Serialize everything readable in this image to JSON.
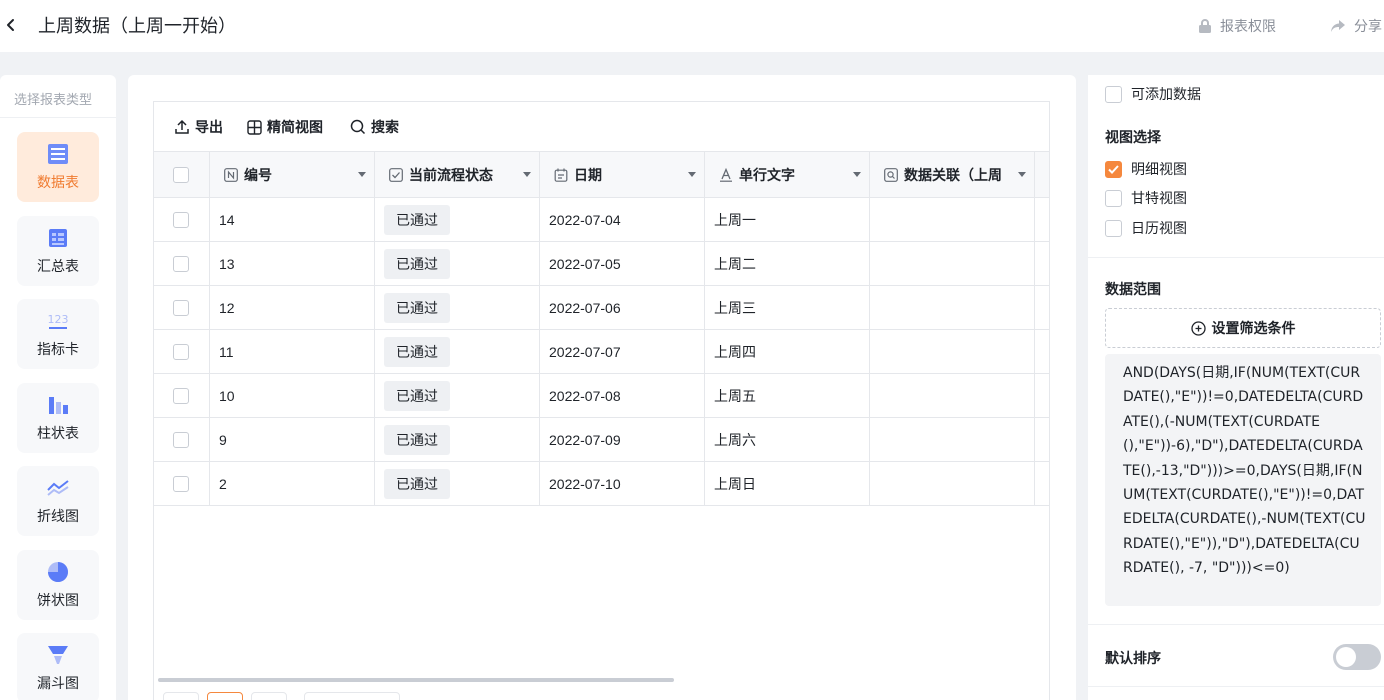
{
  "header": {
    "title": "上周数据（上周一开始）",
    "permissions_label": "报表权限",
    "share_label": "分享"
  },
  "left_panel": {
    "title": "选择报表类型",
    "types": [
      {
        "label": "数据表",
        "icon": "table-icon",
        "active": true
      },
      {
        "label": "汇总表",
        "icon": "pivot-table-icon",
        "active": false
      },
      {
        "label": "指标卡",
        "icon": "metric-card-icon",
        "active": false
      },
      {
        "label": "柱状表",
        "icon": "bar-chart-icon",
        "active": false
      },
      {
        "label": "折线图",
        "icon": "line-chart-icon",
        "active": false
      },
      {
        "label": "饼状图",
        "icon": "pie-chart-icon",
        "active": false
      },
      {
        "label": "漏斗图",
        "icon": "funnel-chart-icon",
        "active": false
      }
    ]
  },
  "toolbar": {
    "export_label": "导出",
    "compact_view_label": "精简视图",
    "search_label": "搜索"
  },
  "table": {
    "columns": [
      "编号",
      "当前流程状态",
      "日期",
      "单行文字",
      "数据关联（上周"
    ],
    "rows": [
      {
        "id": "14",
        "status": "已通过",
        "date": "2022-07-04",
        "text": "上周一",
        "relation": ""
      },
      {
        "id": "13",
        "status": "已通过",
        "date": "2022-07-05",
        "text": "上周二",
        "relation": ""
      },
      {
        "id": "12",
        "status": "已通过",
        "date": "2022-07-06",
        "text": "上周三",
        "relation": ""
      },
      {
        "id": "11",
        "status": "已通过",
        "date": "2022-07-07",
        "text": "上周四",
        "relation": ""
      },
      {
        "id": "10",
        "status": "已通过",
        "date": "2022-07-08",
        "text": "上周五",
        "relation": ""
      },
      {
        "id": "9",
        "status": "已通过",
        "date": "2022-07-09",
        "text": "上周六",
        "relation": ""
      },
      {
        "id": "2",
        "status": "已通过",
        "date": "2022-07-10",
        "text": "上周日",
        "relation": ""
      }
    ]
  },
  "right_panel": {
    "addable_label": "可添加数据",
    "addable_checked": false,
    "view_section_title": "视图选择",
    "views": [
      {
        "label": "明细视图",
        "checked": true
      },
      {
        "label": "甘特视图",
        "checked": false
      },
      {
        "label": "日历视图",
        "checked": false
      }
    ],
    "range_section_title": "数据范围",
    "filter_button_label": "设置筛选条件",
    "formula": "AND(DAYS(日期,IF(NUM(TEXT(CURDATE(),\"E\"))!=0,DATEDELTA(CURDATE(),(-NUM(TEXT(CURDATE(),\"E\"))-6),\"D\"),DATEDELTA(CURDATE(),-13,\"D\")))>=0,DAYS(日期,IF(NUM(TEXT(CURDATE(),\"E\"))!=0,DATEDELTA(CURDATE(),-NUM(TEXT(CURDATE(),\"E\")),\"D\"),DATEDELTA(CURDATE(), -7, \"D\")))<=0)",
    "sort_section_title": "默认排序",
    "sort_enabled": false
  },
  "colors": {
    "accent": "#f5883e",
    "icon_blue": "#5b7cf7"
  }
}
